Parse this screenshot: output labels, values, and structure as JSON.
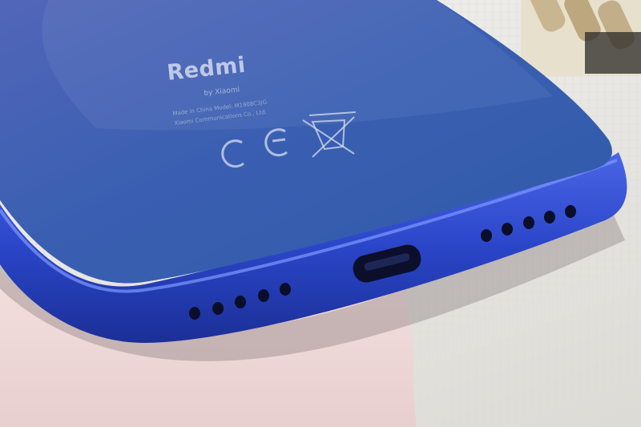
{
  "phone": {
    "brand": "Redmi",
    "byline": "by Xiaomi",
    "fine_print_1": "Made in China  Model: M1908C3JG",
    "fine_print_2": "Xiaomi Communications Co., Ltd."
  },
  "colors": {
    "phone_body": "#2e4fc4",
    "back_glass": "#3a5fb8",
    "towel": "#f0d9d9",
    "backdrop": "#e9e8e4"
  }
}
